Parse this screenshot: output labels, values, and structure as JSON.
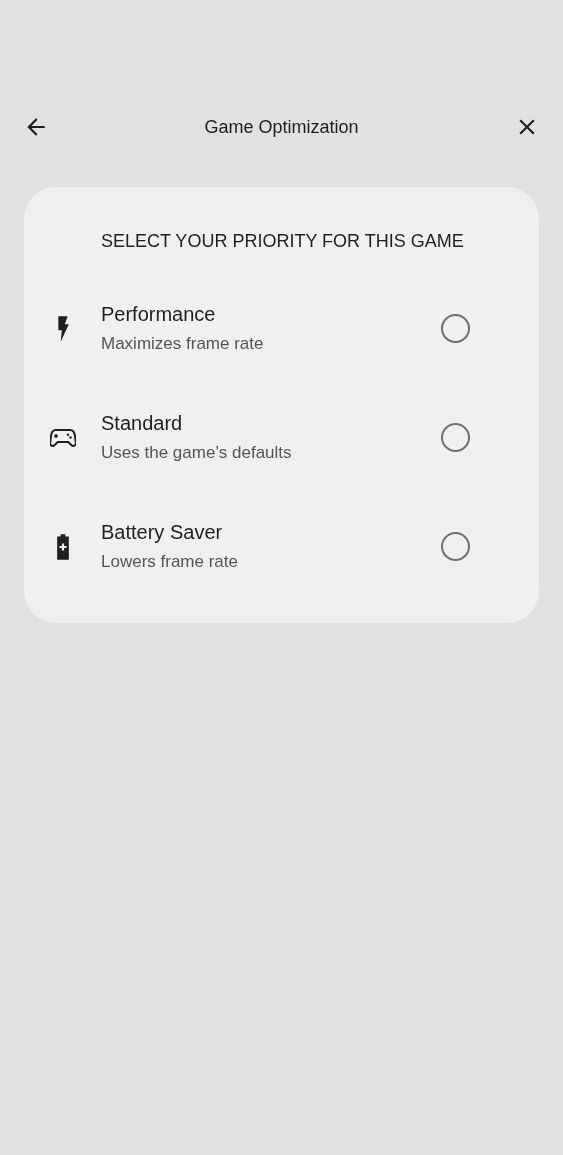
{
  "header": {
    "title": "Game Optimization"
  },
  "card": {
    "heading": "SELECT YOUR PRIORITY FOR THIS GAME",
    "options": [
      {
        "kind": "performance",
        "title": "Performance",
        "subtitle": "Maximizes frame rate",
        "selected": false
      },
      {
        "kind": "standard",
        "title": "Standard",
        "subtitle": "Uses the game’s defaults",
        "selected": false
      },
      {
        "kind": "battery",
        "title": "Battery Saver",
        "subtitle": "Lowers frame rate",
        "selected": false
      }
    ]
  }
}
